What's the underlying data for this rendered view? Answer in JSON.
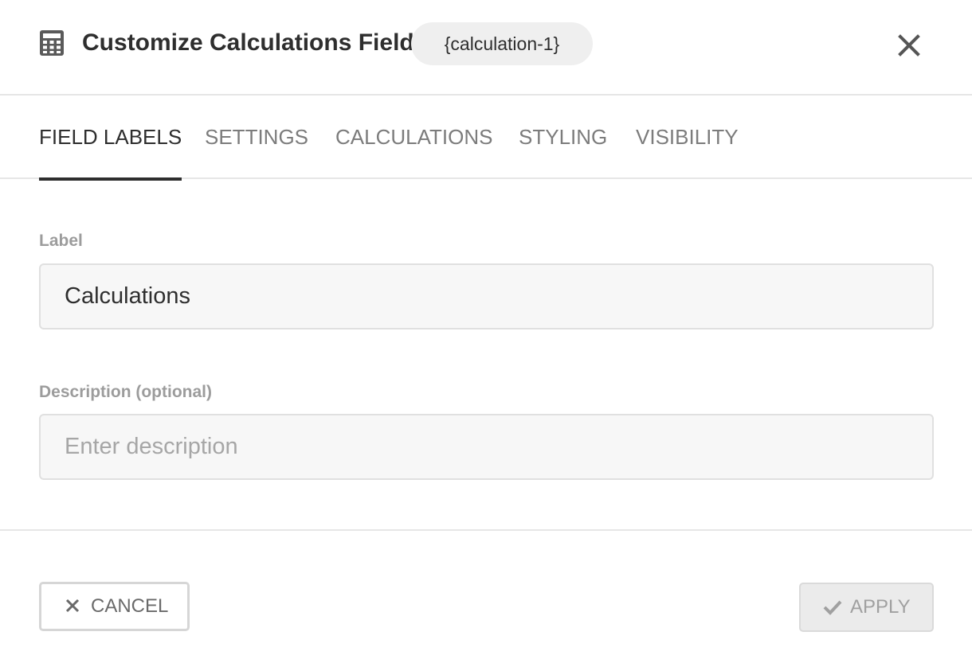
{
  "header": {
    "title": "Customize Calculations Field",
    "field_tag": "{calculation-1}",
    "icon": "calculator-icon",
    "close_icon": "close-icon"
  },
  "tabs": [
    {
      "label": "FIELD LABELS",
      "active": true
    },
    {
      "label": "SETTINGS",
      "active": false
    },
    {
      "label": "CALCULATIONS",
      "active": false
    },
    {
      "label": "STYLING",
      "active": false
    },
    {
      "label": "VISIBILITY",
      "active": false
    }
  ],
  "form": {
    "label_field": {
      "label": "Label",
      "value": "Calculations"
    },
    "description_field": {
      "label": "Description (optional)",
      "value": "",
      "placeholder": "Enter description"
    }
  },
  "footer": {
    "cancel_label": "CANCEL",
    "cancel_icon": "close-icon",
    "apply_label": "APPLY",
    "apply_icon": "checkmark-icon",
    "apply_disabled": true
  },
  "colors": {
    "text_dark": "#2e2e2e",
    "text_muted": "#7c7c7c",
    "divider": "#e6e6e6",
    "input_bg": "#f7f7f7"
  }
}
